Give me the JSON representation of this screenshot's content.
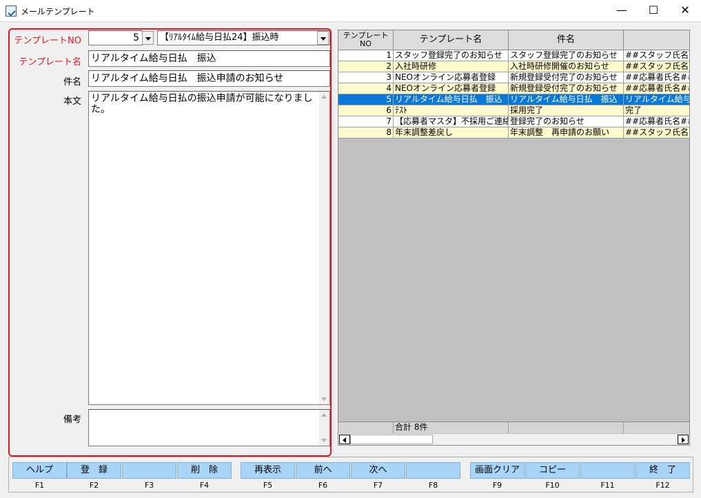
{
  "window": {
    "title": "メールテンプレート",
    "icon": "app-icon",
    "controls": [
      "minimize-icon",
      "maximize-icon",
      "close-icon"
    ]
  },
  "form": {
    "template_no_label": "テンプレートNO",
    "template_no_value": "5",
    "template_select_value": "【ﾘｱﾙﾀｲﾑ給与日払24】振込時",
    "template_name_label": "テンプレート名",
    "template_name_value": "リアルタイム給与日払　振込",
    "subject_label": "件名",
    "subject_value": "リアルタイム給与日払　振込申請のお知らせ",
    "body_label": "本文",
    "body_value": "リアルタイム給与日払の振込申請が可能になりました。",
    "remarks_label": "備考",
    "remarks_value": ""
  },
  "grid": {
    "columns": [
      "テンプレートNO",
      "テンプレート名",
      "件名",
      ""
    ],
    "rows": [
      {
        "no": "1",
        "name": "スタッフ登録完了のお知らせ",
        "subject": "スタッフ登録完了のお知らせ",
        "body": "##スタッフ氏名##"
      },
      {
        "no": "2",
        "name": "入社時研修",
        "subject": "入社時研修開催のお知らせ",
        "body": "##スタッフ氏名##"
      },
      {
        "no": "3",
        "name": "NEOオンライン応募者登録",
        "subject": "新規登録受付完了のお知らせ",
        "body": "##応募者氏名##"
      },
      {
        "no": "4",
        "name": "NEOオンライン応募者登録",
        "subject": "新規登録受付完了のお知らせ",
        "body": "##応募者氏名##"
      },
      {
        "no": "5",
        "name": "リアルタイム給与日払　振込",
        "subject": "リアルタイム給与日払　振込",
        "body": "リアルタイム給与日払"
      },
      {
        "no": "6",
        "name": "ﾃｽﾄ",
        "subject": "採用完了",
        "body": "完了"
      },
      {
        "no": "7",
        "name": "【応募者マスタ】不採用ご連絡",
        "subject": "登録完了のお知らせ",
        "body": "##応募者氏名##"
      },
      {
        "no": "8",
        "name": "年末調整差戻し",
        "subject": "年末調整　再申請のお願い",
        "body": "##スタッフ氏名##"
      }
    ],
    "selected_row": 4,
    "total_label": "合計 8件",
    "colors": {
      "odd": "#ffffff",
      "even": "#fffacd",
      "selected": "#0a78d7",
      "header": "#dcdcdc"
    }
  },
  "buttons": [
    {
      "label": "ヘルプ",
      "key": "F1"
    },
    {
      "label": "登　録",
      "key": "F2"
    },
    {
      "label": "",
      "key": "F3"
    },
    {
      "label": "削　除",
      "key": "F4"
    },
    {
      "label": "再表示",
      "key": "F5"
    },
    {
      "label": "前へ",
      "key": "F6"
    },
    {
      "label": "次へ",
      "key": "F7"
    },
    {
      "label": "",
      "key": "F8"
    },
    {
      "label": "画面クリア",
      "key": "F9"
    },
    {
      "label": "コピー",
      "key": "F10"
    },
    {
      "label": "",
      "key": "F11"
    },
    {
      "label": "終　了",
      "key": "F12"
    }
  ],
  "accent": {
    "frame": "#e8141e",
    "button": "#a8d4f8"
  }
}
